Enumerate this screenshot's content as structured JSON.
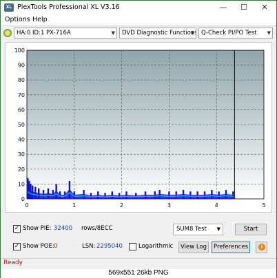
{
  "window": {
    "title": "PlexTools Professional XL V3.16",
    "icon_text": "XL",
    "controls": {
      "minimize": "—",
      "maximize": "☐",
      "close": "✕"
    }
  },
  "menu": {
    "options": "Options",
    "help": "Help"
  },
  "toolbar": {
    "drive": "HA:0 ID:1  PX-716A",
    "function": "DVD Diagnostic Functions",
    "test": "Q-Check PI/PO Test",
    "dropdown_glyph": "▼"
  },
  "chart_data": {
    "type": "bar",
    "title": "",
    "xlabel": "",
    "ylabel": "",
    "xlim": [
      0,
      5
    ],
    "ylim": [
      0,
      100
    ],
    "x_ticks": [
      "0",
      "1",
      "2",
      "3",
      "4",
      "5"
    ],
    "y_ticks": [
      "0",
      "10",
      "20",
      "30",
      "40",
      "50",
      "60",
      "70",
      "80",
      "90",
      "100"
    ],
    "grid": true,
    "end_marker_x": 4.38,
    "colors": {
      "bars": "#1010e0",
      "average_line": "#00c8f0",
      "background_top": "#8fa5aa",
      "background_bottom": "#ffffff"
    },
    "series": [
      {
        "values": [
          {
            "x": 0.02,
            "y": 14
          },
          {
            "x": 0.05,
            "y": 12
          },
          {
            "x": 0.08,
            "y": 10
          },
          {
            "x": 0.12,
            "y": 9
          },
          {
            "x": 0.18,
            "y": 8
          },
          {
            "x": 0.25,
            "y": 7
          },
          {
            "x": 0.35,
            "y": 6
          },
          {
            "x": 0.45,
            "y": 7
          },
          {
            "x": 0.55,
            "y": 6
          },
          {
            "x": 0.62,
            "y": 10
          },
          {
            "x": 0.7,
            "y": 5
          },
          {
            "x": 0.8,
            "y": 5
          },
          {
            "x": 0.9,
            "y": 12
          },
          {
            "x": 1.0,
            "y": 5
          },
          {
            "x": 1.2,
            "y": 6
          },
          {
            "x": 1.35,
            "y": 4
          },
          {
            "x": 1.5,
            "y": 5
          },
          {
            "x": 1.65,
            "y": 4
          },
          {
            "x": 1.8,
            "y": 5
          },
          {
            "x": 1.95,
            "y": 4
          },
          {
            "x": 2.1,
            "y": 5
          },
          {
            "x": 2.3,
            "y": 4
          },
          {
            "x": 2.5,
            "y": 5
          },
          {
            "x": 2.7,
            "y": 5
          },
          {
            "x": 2.8,
            "y": 6
          },
          {
            "x": 3.0,
            "y": 5
          },
          {
            "x": 3.15,
            "y": 5
          },
          {
            "x": 3.3,
            "y": 6
          },
          {
            "x": 3.45,
            "y": 5
          },
          {
            "x": 3.6,
            "y": 5
          },
          {
            "x": 3.75,
            "y": 5
          },
          {
            "x": 3.9,
            "y": 6
          },
          {
            "x": 4.05,
            "y": 5
          },
          {
            "x": 4.2,
            "y": 6
          },
          {
            "x": 4.35,
            "y": 5
          }
        ]
      }
    ]
  },
  "controls": {
    "show_pie_label": "Show PIE:",
    "show_pie_checked": "✓",
    "pie_value": "32400",
    "rows_label": "rows/8ECC",
    "show_poe_label": "Show POE:",
    "show_poe_checked": "✓",
    "poe_value": "0",
    "lsn_label": "LSN:",
    "lsn_value": "2295040",
    "logarithmic_label": "Logarithmic",
    "sum_select": "SUM8 Test",
    "start_button": "Start",
    "view_log_button": "View Log",
    "preferences_button": "Preferences",
    "info_glyph": "i"
  },
  "status": {
    "text": "Ready"
  },
  "caption": {
    "text": "569x551  26kb  PNG"
  }
}
